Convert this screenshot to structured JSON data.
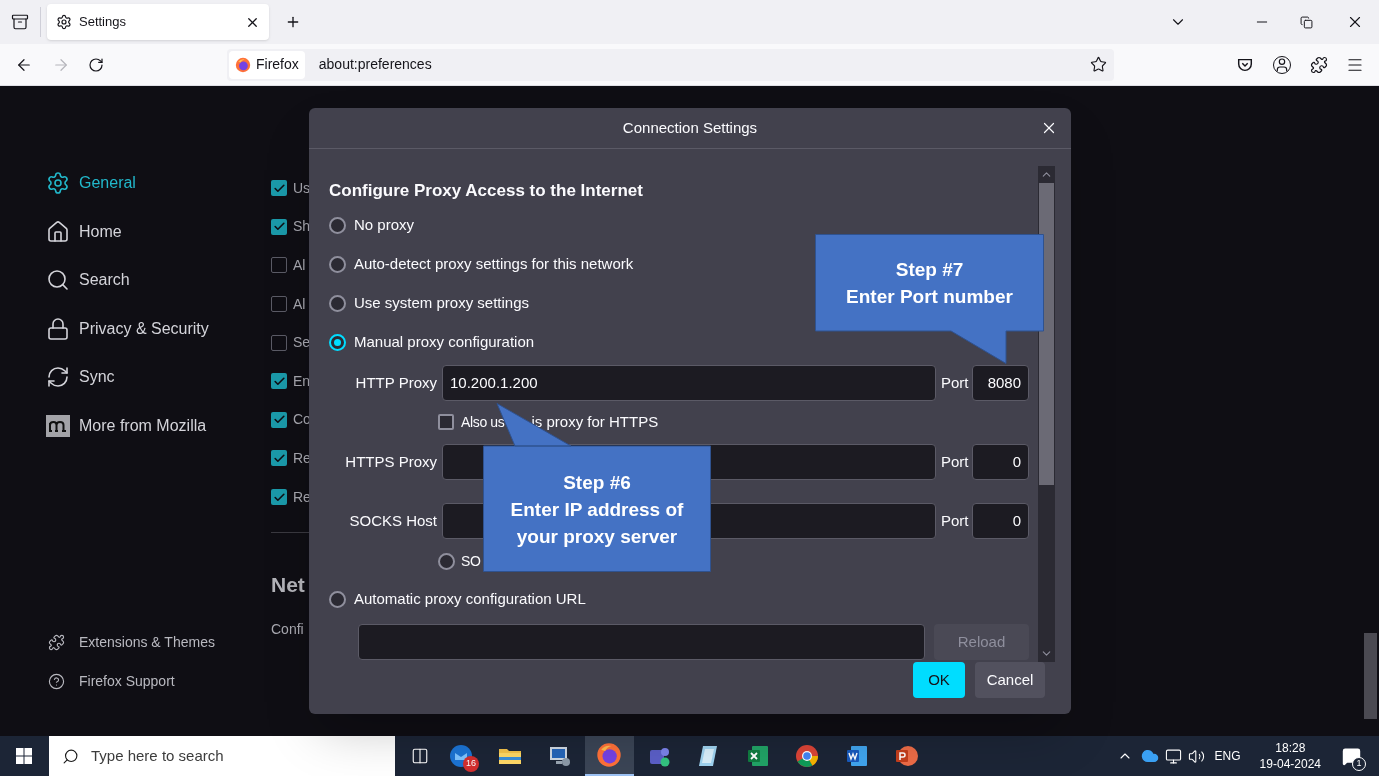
{
  "browser": {
    "tabs": [
      {
        "label": "Settings",
        "selected": true
      }
    ],
    "forward": {
      "disabled": true
    },
    "identity": "Firefox",
    "url": "about:preferences"
  },
  "sidebar": {
    "items": [
      {
        "label": "General",
        "kind": "gear",
        "selected": true
      },
      {
        "label": "Home",
        "kind": "home",
        "selected": false
      },
      {
        "label": "Search",
        "kind": "search",
        "selected": false
      },
      {
        "label": "Privacy & Security",
        "kind": "lock",
        "selected": false
      },
      {
        "label": "Sync",
        "kind": "sync",
        "selected": false
      },
      {
        "label": "More from Mozilla",
        "kind": "mozilla",
        "selected": false
      }
    ],
    "footer": [
      {
        "label": "Extensions & Themes",
        "kind": "puzzle"
      },
      {
        "label": "Firefox Support",
        "kind": "help"
      }
    ]
  },
  "page": {
    "checkboxes": [
      {
        "label": "Us",
        "checked": true
      },
      {
        "label": "Sh",
        "checked": true
      },
      {
        "label": "Al",
        "checked": false
      },
      {
        "label": "Al",
        "checked": false
      },
      {
        "label": "Se",
        "checked": false
      },
      {
        "label": "En",
        "checked": true
      },
      {
        "label": "Co",
        "checked": true
      },
      {
        "label": "Re",
        "checked": true
      },
      {
        "label": "Re",
        "checked": true
      }
    ],
    "heading": "Net",
    "text": "Confi"
  },
  "dialog": {
    "title": "Connection Settings",
    "heading": "Configure Proxy Access to the Internet",
    "modes": [
      {
        "label": "No proxy",
        "kind": "plain",
        "selected": false
      },
      {
        "label": "Auto-detect proxy settings for this network",
        "kind": "plain",
        "selected": false
      },
      {
        "label": "Use system proxy settings",
        "kind": "plain",
        "selected": false
      },
      {
        "label": "Manual proxy configuration",
        "kind": "manual",
        "selected": true
      },
      {
        "label": "Automatic proxy configuration URL",
        "kind": "url",
        "selected": false
      }
    ],
    "manual": {
      "rows": [
        {
          "label": "HTTP Proxy",
          "value": "10.200.1.200",
          "port_label": "Port",
          "port": "8080"
        },
        {
          "label": "HTTPS Proxy",
          "port_label": "Port",
          "port": "0"
        },
        {
          "label": "SOCKS Host",
          "port_label": "Port",
          "port": "0"
        }
      ],
      "share": {
        "label_parts": [
          "Also us",
          "is proxy for HTTPS"
        ],
        "checked": false
      },
      "socks_version": {
        "label": "SO",
        "selected": false
      }
    },
    "url": {
      "reload": {
        "label": "Reload",
        "disabled": true
      }
    },
    "buttons": [
      {
        "label": "OK",
        "kind": "primary"
      },
      {
        "label": "Cancel",
        "kind": "secondary"
      }
    ]
  },
  "callouts": [
    {
      "lines": [
        "Step #7",
        "Enter Port number"
      ]
    },
    {
      "lines": [
        "Step #6",
        "Enter IP address of",
        "your proxy server"
      ]
    }
  ],
  "taskbar": {
    "search_placeholder": "Type here to search",
    "apps": [
      {
        "kind": "mail",
        "badge": "16",
        "selected": false
      },
      {
        "kind": "folder",
        "selected": false
      },
      {
        "kind": "computer",
        "selected": false
      },
      {
        "kind": "firefox",
        "selected": true
      },
      {
        "kind": "chat",
        "selected": false
      },
      {
        "kind": "notes",
        "selected": false
      },
      {
        "kind": "sheet",
        "selected": false
      },
      {
        "kind": "chrome",
        "selected": false
      },
      {
        "kind": "doc",
        "selected": false
      },
      {
        "kind": "slides",
        "selected": false
      }
    ],
    "language": "ENG",
    "time": "18:28",
    "date": "19-04-2024",
    "notifications": "1"
  }
}
